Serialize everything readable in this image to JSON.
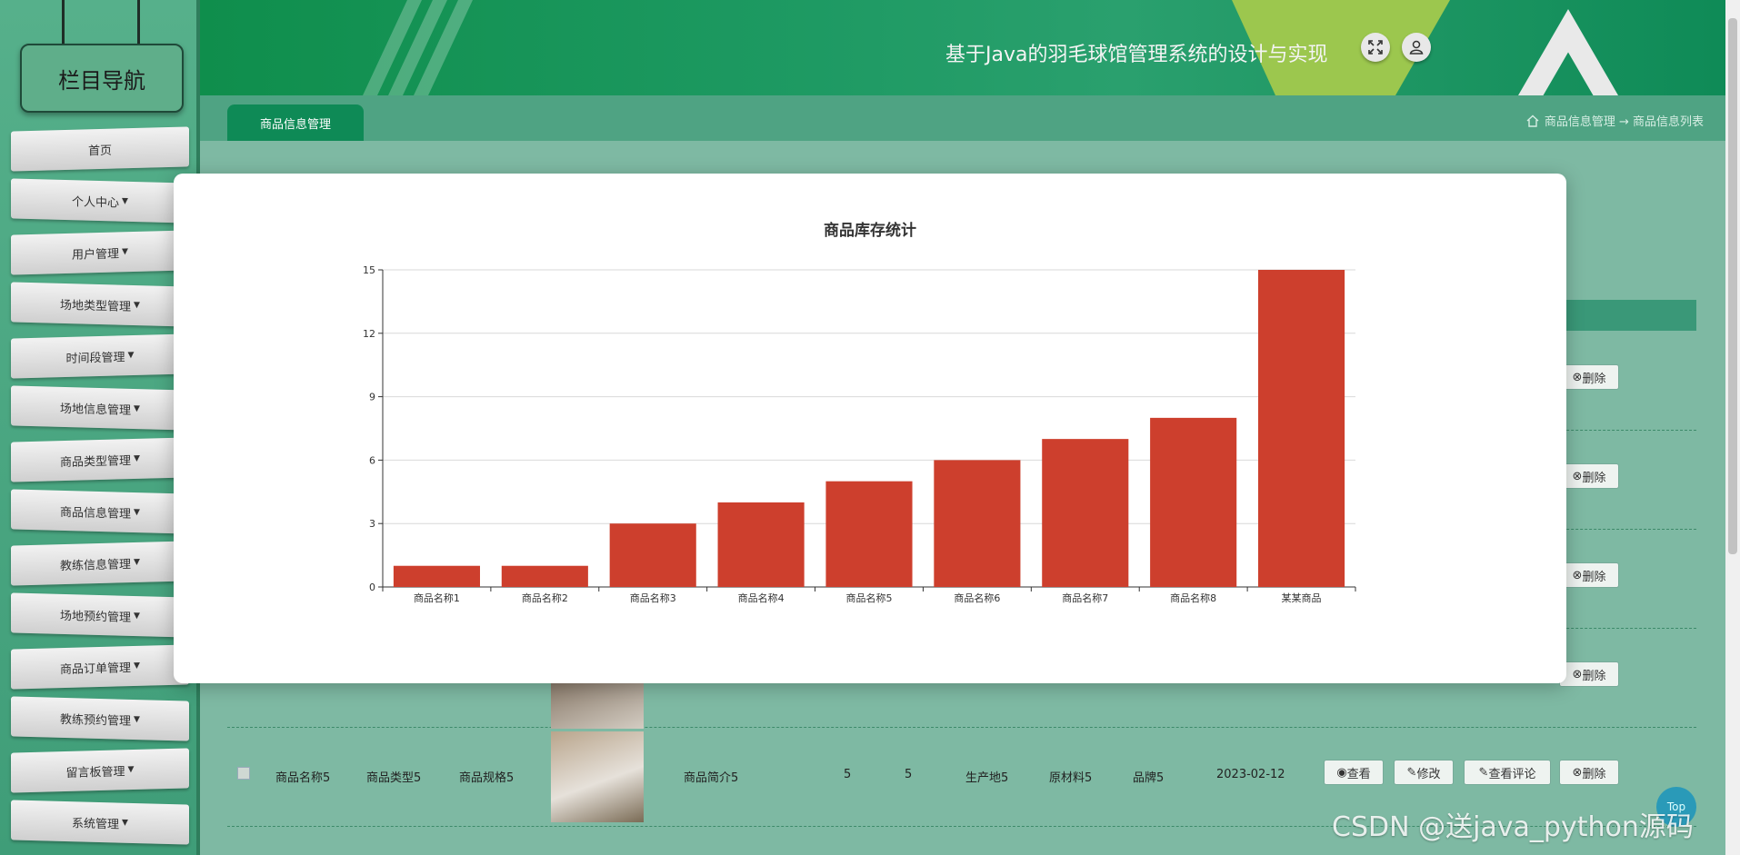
{
  "sidebar": {
    "title": "栏目导航",
    "items": [
      {
        "label": "首页",
        "caret": false
      },
      {
        "label": "个人中心",
        "caret": true
      },
      {
        "label": "用户管理",
        "caret": true
      },
      {
        "label": "场地类型管理",
        "caret": true
      },
      {
        "label": "时间段管理",
        "caret": true
      },
      {
        "label": "场地信息管理",
        "caret": true
      },
      {
        "label": "商品类型管理",
        "caret": true
      },
      {
        "label": "商品信息管理",
        "caret": true
      },
      {
        "label": "教练信息管理",
        "caret": true
      },
      {
        "label": "场地预约管理",
        "caret": true
      },
      {
        "label": "商品订单管理",
        "caret": true
      },
      {
        "label": "教练预约管理",
        "caret": true
      },
      {
        "label": "留言板管理",
        "caret": true
      },
      {
        "label": "系统管理",
        "caret": true
      }
    ]
  },
  "header": {
    "title": "基于Java的羽毛球馆管理系统的设计与实现",
    "icons": [
      "fullscreen-icon",
      "user-icon"
    ]
  },
  "tabs": {
    "active": "商品信息管理"
  },
  "breadcrumb": {
    "icon": "home-icon",
    "text": "商品信息管理 → 商品信息列表"
  },
  "table": {
    "row": {
      "name": "商品名称5",
      "type": "商品类型5",
      "spec": "商品规格5",
      "intro": "商品简介5",
      "col5": "5",
      "col6": "5",
      "origin": "生产地5",
      "material": "原材料5",
      "brand": "品牌5",
      "date": "2023-02-12"
    },
    "actions": {
      "view": "查看",
      "edit": "修改",
      "comments": "查看评论",
      "delete": "删除"
    }
  },
  "chart_data": {
    "type": "bar",
    "title": "商品库存统计",
    "categories": [
      "商品名称1",
      "商品名称2",
      "商品名称3",
      "商品名称4",
      "商品名称5",
      "商品名称6",
      "商品名称7",
      "商品名称8",
      "某某商品"
    ],
    "values": [
      1,
      1,
      3,
      4,
      5,
      6,
      7,
      8,
      15
    ],
    "ylim": [
      0,
      15
    ],
    "yticks": [
      0,
      3,
      6,
      9,
      12,
      15
    ],
    "xlabel": "",
    "ylabel": "",
    "grid": true,
    "bar_color": "#cd3f2d"
  },
  "watermark": "CSDN @送java_python源码",
  "top_button": "Top"
}
